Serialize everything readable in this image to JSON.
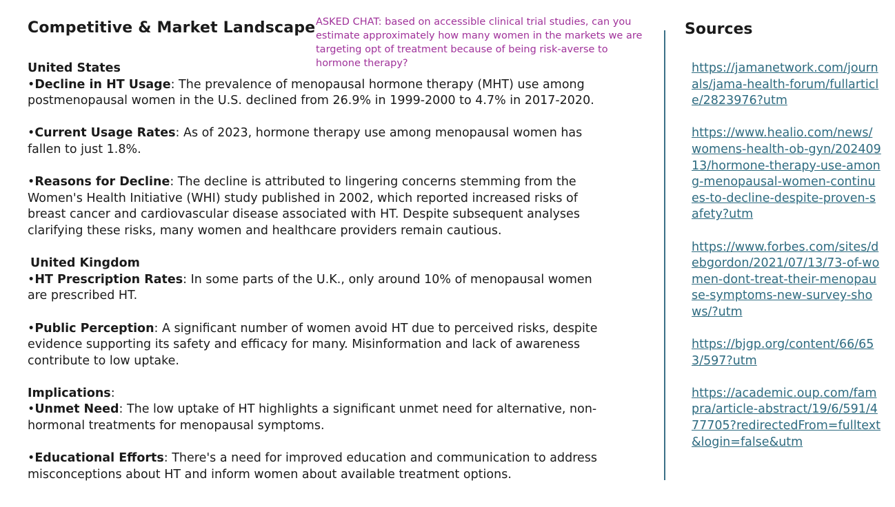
{
  "title": "Competitive & Market Landscape",
  "note": "ASKED CHAT: based on accessible clinical trial studies, can you estimate approximately how many women in the markets we are targeting opt of treatment because of being risk-averse to hormone therapy?",
  "us": {
    "heading": "United States",
    "decline_label": "Decline in HT Usage",
    "decline_text": ": The prevalence of menopausal hormone therapy (MHT) use among postmenopausal women in the U.S. declined from 26.9% in 1999-2000 to 4.7% in 2017-2020.",
    "usage_label": "Current Usage Rates",
    "usage_text": ": As of 2023, hormone therapy use among menopausal women has fallen to just 1.8%.",
    "reasons_label": "Reasons for Decline",
    "reasons_text": ": The decline is attributed to lingering concerns stemming from the Women's Health Initiative (WHI) study published in 2002, which reported increased risks of breast cancer and cardiovascular disease associated with HT. Despite subsequent analyses clarifying these risks, many women and healthcare providers remain cautious."
  },
  "uk": {
    "heading": "United Kingdom",
    "rx_label": "HT Prescription Rates",
    "rx_text": ": In some parts of the U.K., only around 10% of menopausal women are prescribed HT.",
    "perception_label": "Public Perception",
    "perception_text": ": A significant number of women avoid HT due to perceived risks, despite evidence supporting its safety and efficacy for many. Misinformation and lack of awareness contribute to low uptake."
  },
  "implications": {
    "heading": "Implications",
    "unmet_label": "Unmet Need",
    "unmet_text": ": The low uptake of HT highlights a significant unmet need for alternative, non-hormonal treatments for menopausal symptoms.",
    "edu_label": "Educational Efforts",
    "edu_text": ": There's a need for improved education and communication to address misconceptions about HT and inform women about available treatment options."
  },
  "sources": {
    "title": "Sources",
    "links": [
      "https://jamanetwork.com/journals/jama-health-forum/fullarticle/2823976?utm",
      "https://www.healio.com/news/womens-health-ob-gyn/20240913/hormone-therapy-use-among-menopausal-women-continues-to-decline-despite-proven-safety?utm",
      "https://www.forbes.com/sites/debgordon/2021/07/13/73-of-women-dont-treat-their-menopause-symptoms-new-survey-shows/?utm",
      "https://bjgp.org/content/66/653/597?utm",
      "https://academic.oup.com/fampra/article-abstract/19/6/591/477705?redirectedFrom=fulltext&login=false&utm"
    ]
  }
}
